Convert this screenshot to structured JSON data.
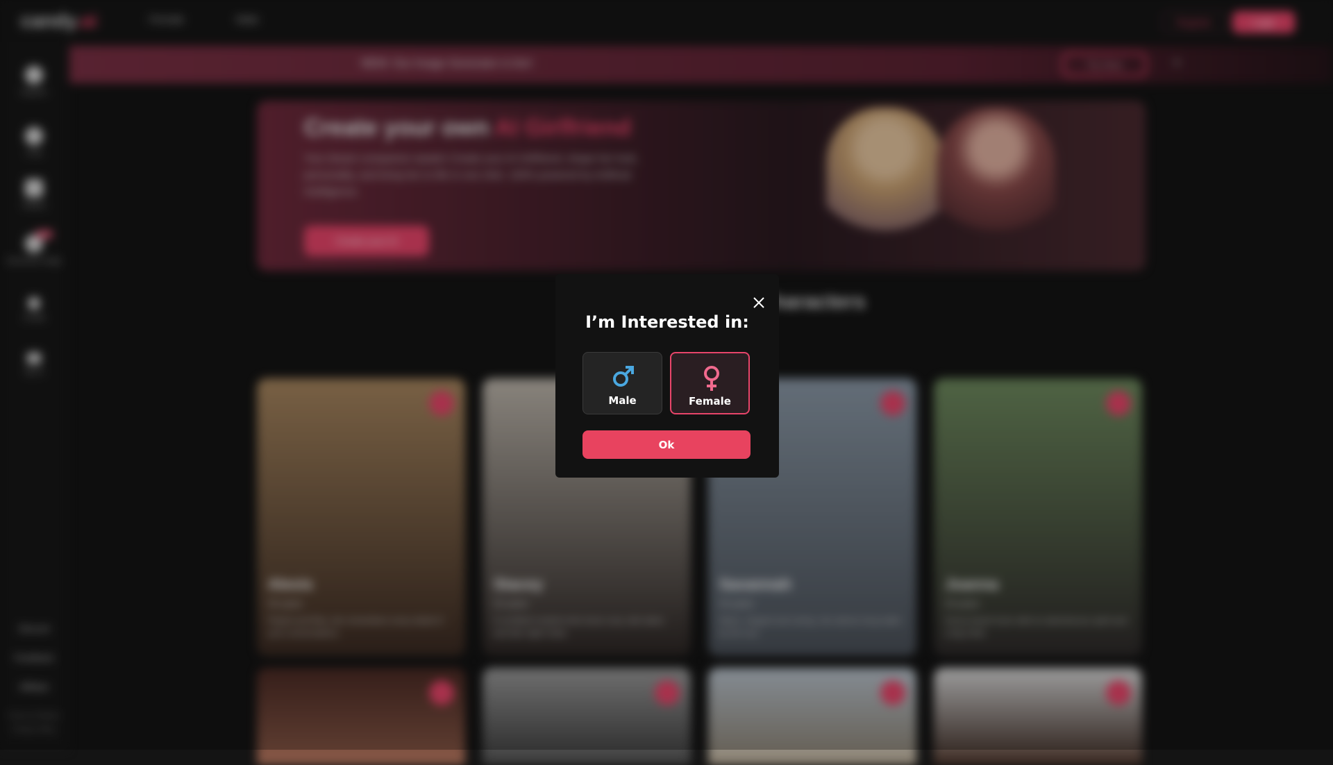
{
  "topbar": {
    "logo_main": "candy",
    "logo_accent": ".ai",
    "nav": [
      "Female",
      "Male"
    ],
    "register_label": "Register",
    "login_label": "Login"
  },
  "sidebar": {
    "items": [
      "Explore",
      "Chat",
      "Gallery",
      "Generate Image",
      "Create",
      "My AI"
    ],
    "new_badge": "New",
    "footer": [
      "Discord",
      "Feedback",
      "Affiliate"
    ],
    "tiny": [
      "Terms & Policies",
      "Privacy Policy"
    ]
  },
  "banner": {
    "text": "NEW: Our Image Generator is live!",
    "try_label": "Try Now",
    "close_glyph": "×"
  },
  "hero": {
    "title_main": "Create your own",
    "title_accent": "AI Girlfriend",
    "description": "Your dream companion awaits! Create your AI Girlfriend, shape her look, personality, and bring her to life in one click. 100% powered by Artificial Intelligence.",
    "button_label": "Create your AI"
  },
  "section": {
    "title": "Characters"
  },
  "cards": [
    {
      "name": "Alexis",
      "age": "25 years",
      "desc": "Playful and flirty, she remembers every detail of your conversations.",
      "colors": [
        "#a7865f",
        "#3a2a22"
      ]
    },
    {
      "name": "Stacey",
      "age": "22 years",
      "desc": "A confident student who loves cozy cafe dates and late night chats.",
      "colors": [
        "#bdb6ac",
        "#2c2624"
      ]
    },
    {
      "name": "Savannah",
      "age": "44 years",
      "desc": "Warm, elegant and caring, she adores long walks by the sea.",
      "colors": [
        "#8a98a6",
        "#4a5058"
      ]
    },
    {
      "name": "Joanna",
      "age": "23 years",
      "desc": "Sunny beach lover with an adventurous spirit and a big smile.",
      "colors": [
        "#6e8a5e",
        "#2e2a2a"
      ]
    }
  ],
  "cards_row2": [
    {
      "colors": [
        "#4a2a24",
        "#8a5a48"
      ]
    },
    {
      "colors": [
        "#9a9a9a",
        "#3a3a3a"
      ]
    },
    {
      "colors": [
        "#b8c2cc",
        "#8a8070"
      ]
    },
    {
      "colors": [
        "#d8d8d8",
        "#3a2820"
      ]
    }
  ],
  "modal": {
    "title": "I’m Interested in:",
    "options": [
      {
        "label": "Male",
        "selected": false,
        "color": "#4aa8e0",
        "icon": "male-symbol-icon"
      },
      {
        "label": "Female",
        "selected": true,
        "color": "#f06a8e",
        "icon": "female-symbol-icon"
      }
    ],
    "ok_label": "Ok",
    "accent": "#e8435f"
  }
}
